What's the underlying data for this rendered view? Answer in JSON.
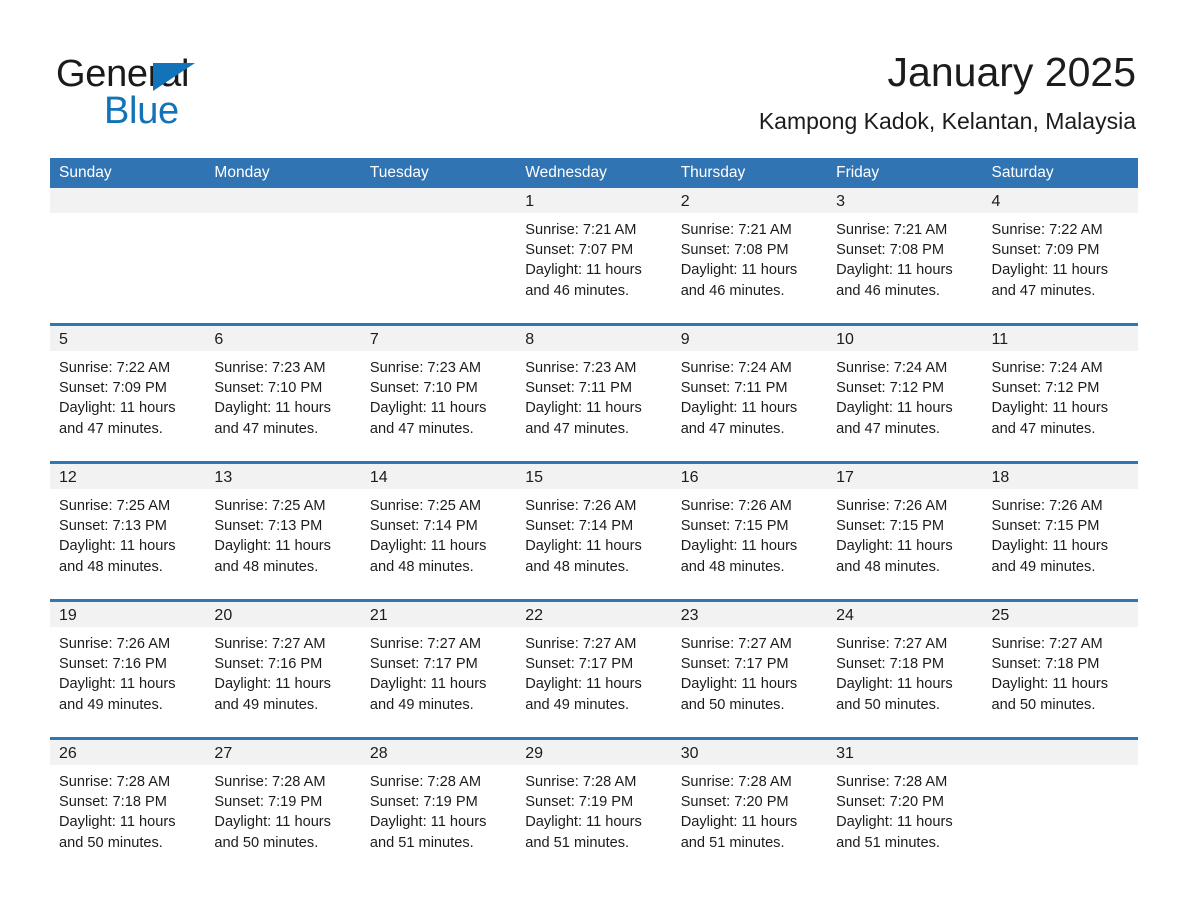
{
  "brand": {
    "line1": "General",
    "line2": "Blue",
    "triangle_color": "#1273b8"
  },
  "header": {
    "title": "January 2025",
    "subtitle": "Kampong Kadok, Kelantan, Malaysia"
  },
  "colors": {
    "header_blue": "#3074b4",
    "row_divider_blue": "#2f76b5",
    "daynum_band": "#f2f2f2",
    "text": "#1c1c1c"
  },
  "weekday_headers": [
    "Sunday",
    "Monday",
    "Tuesday",
    "Wednesday",
    "Thursday",
    "Friday",
    "Saturday"
  ],
  "weeks": [
    [
      {
        "day": "",
        "lines": []
      },
      {
        "day": "",
        "lines": []
      },
      {
        "day": "",
        "lines": []
      },
      {
        "day": "1",
        "lines": [
          "Sunrise: 7:21 AM",
          "Sunset: 7:07 PM",
          "Daylight: 11 hours",
          "and 46 minutes."
        ]
      },
      {
        "day": "2",
        "lines": [
          "Sunrise: 7:21 AM",
          "Sunset: 7:08 PM",
          "Daylight: 11 hours",
          "and 46 minutes."
        ]
      },
      {
        "day": "3",
        "lines": [
          "Sunrise: 7:21 AM",
          "Sunset: 7:08 PM",
          "Daylight: 11 hours",
          "and 46 minutes."
        ]
      },
      {
        "day": "4",
        "lines": [
          "Sunrise: 7:22 AM",
          "Sunset: 7:09 PM",
          "Daylight: 11 hours",
          "and 47 minutes."
        ]
      }
    ],
    [
      {
        "day": "5",
        "lines": [
          "Sunrise: 7:22 AM",
          "Sunset: 7:09 PM",
          "Daylight: 11 hours",
          "and 47 minutes."
        ]
      },
      {
        "day": "6",
        "lines": [
          "Sunrise: 7:23 AM",
          "Sunset: 7:10 PM",
          "Daylight: 11 hours",
          "and 47 minutes."
        ]
      },
      {
        "day": "7",
        "lines": [
          "Sunrise: 7:23 AM",
          "Sunset: 7:10 PM",
          "Daylight: 11 hours",
          "and 47 minutes."
        ]
      },
      {
        "day": "8",
        "lines": [
          "Sunrise: 7:23 AM",
          "Sunset: 7:11 PM",
          "Daylight: 11 hours",
          "and 47 minutes."
        ]
      },
      {
        "day": "9",
        "lines": [
          "Sunrise: 7:24 AM",
          "Sunset: 7:11 PM",
          "Daylight: 11 hours",
          "and 47 minutes."
        ]
      },
      {
        "day": "10",
        "lines": [
          "Sunrise: 7:24 AM",
          "Sunset: 7:12 PM",
          "Daylight: 11 hours",
          "and 47 minutes."
        ]
      },
      {
        "day": "11",
        "lines": [
          "Sunrise: 7:24 AM",
          "Sunset: 7:12 PM",
          "Daylight: 11 hours",
          "and 47 minutes."
        ]
      }
    ],
    [
      {
        "day": "12",
        "lines": [
          "Sunrise: 7:25 AM",
          "Sunset: 7:13 PM",
          "Daylight: 11 hours",
          "and 48 minutes."
        ]
      },
      {
        "day": "13",
        "lines": [
          "Sunrise: 7:25 AM",
          "Sunset: 7:13 PM",
          "Daylight: 11 hours",
          "and 48 minutes."
        ]
      },
      {
        "day": "14",
        "lines": [
          "Sunrise: 7:25 AM",
          "Sunset: 7:14 PM",
          "Daylight: 11 hours",
          "and 48 minutes."
        ]
      },
      {
        "day": "15",
        "lines": [
          "Sunrise: 7:26 AM",
          "Sunset: 7:14 PM",
          "Daylight: 11 hours",
          "and 48 minutes."
        ]
      },
      {
        "day": "16",
        "lines": [
          "Sunrise: 7:26 AM",
          "Sunset: 7:15 PM",
          "Daylight: 11 hours",
          "and 48 minutes."
        ]
      },
      {
        "day": "17",
        "lines": [
          "Sunrise: 7:26 AM",
          "Sunset: 7:15 PM",
          "Daylight: 11 hours",
          "and 48 minutes."
        ]
      },
      {
        "day": "18",
        "lines": [
          "Sunrise: 7:26 AM",
          "Sunset: 7:15 PM",
          "Daylight: 11 hours",
          "and 49 minutes."
        ]
      }
    ],
    [
      {
        "day": "19",
        "lines": [
          "Sunrise: 7:26 AM",
          "Sunset: 7:16 PM",
          "Daylight: 11 hours",
          "and 49 minutes."
        ]
      },
      {
        "day": "20",
        "lines": [
          "Sunrise: 7:27 AM",
          "Sunset: 7:16 PM",
          "Daylight: 11 hours",
          "and 49 minutes."
        ]
      },
      {
        "day": "21",
        "lines": [
          "Sunrise: 7:27 AM",
          "Sunset: 7:17 PM",
          "Daylight: 11 hours",
          "and 49 minutes."
        ]
      },
      {
        "day": "22",
        "lines": [
          "Sunrise: 7:27 AM",
          "Sunset: 7:17 PM",
          "Daylight: 11 hours",
          "and 49 minutes."
        ]
      },
      {
        "day": "23",
        "lines": [
          "Sunrise: 7:27 AM",
          "Sunset: 7:17 PM",
          "Daylight: 11 hours",
          "and 50 minutes."
        ]
      },
      {
        "day": "24",
        "lines": [
          "Sunrise: 7:27 AM",
          "Sunset: 7:18 PM",
          "Daylight: 11 hours",
          "and 50 minutes."
        ]
      },
      {
        "day": "25",
        "lines": [
          "Sunrise: 7:27 AM",
          "Sunset: 7:18 PM",
          "Daylight: 11 hours",
          "and 50 minutes."
        ]
      }
    ],
    [
      {
        "day": "26",
        "lines": [
          "Sunrise: 7:28 AM",
          "Sunset: 7:18 PM",
          "Daylight: 11 hours",
          "and 50 minutes."
        ]
      },
      {
        "day": "27",
        "lines": [
          "Sunrise: 7:28 AM",
          "Sunset: 7:19 PM",
          "Daylight: 11 hours",
          "and 50 minutes."
        ]
      },
      {
        "day": "28",
        "lines": [
          "Sunrise: 7:28 AM",
          "Sunset: 7:19 PM",
          "Daylight: 11 hours",
          "and 51 minutes."
        ]
      },
      {
        "day": "29",
        "lines": [
          "Sunrise: 7:28 AM",
          "Sunset: 7:19 PM",
          "Daylight: 11 hours",
          "and 51 minutes."
        ]
      },
      {
        "day": "30",
        "lines": [
          "Sunrise: 7:28 AM",
          "Sunset: 7:20 PM",
          "Daylight: 11 hours",
          "and 51 minutes."
        ]
      },
      {
        "day": "31",
        "lines": [
          "Sunrise: 7:28 AM",
          "Sunset: 7:20 PM",
          "Daylight: 11 hours",
          "and 51 minutes."
        ]
      },
      {
        "day": "",
        "lines": []
      }
    ]
  ]
}
